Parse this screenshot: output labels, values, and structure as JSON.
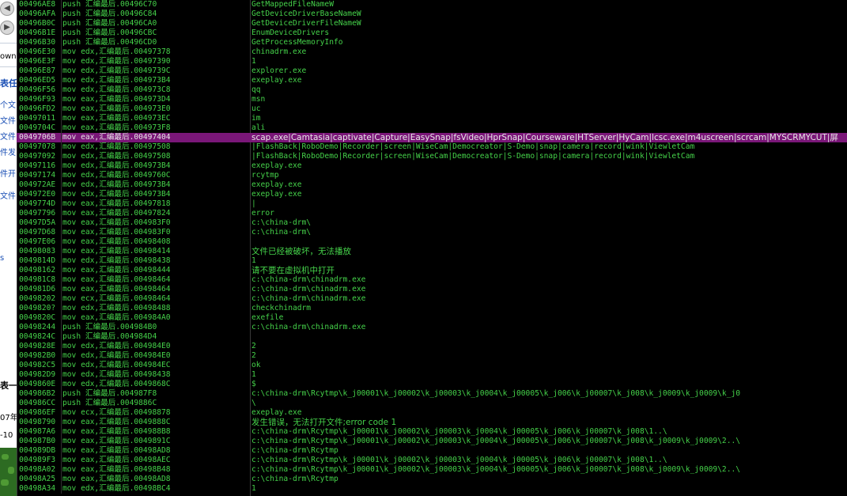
{
  "background_window": {
    "fragments": [
      "own",
      "表任",
      "个文",
      "文件",
      "文件",
      "件发",
      "件开",
      "文件",
      "s",
      "表一0",
      "07年",
      "-10"
    ]
  },
  "disasm": {
    "rows": [
      {
        "addr": "00496AE8",
        "instr": "push 汇编最后.00496C70",
        "comment": "GetMappedFileNameW"
      },
      {
        "addr": "00496AFA",
        "instr": "push 汇编最后.00496C84",
        "comment": "GetDeviceDriverBaseNameW"
      },
      {
        "addr": "00496B0C",
        "instr": "push 汇编最后.00496CA0",
        "comment": "GetDeviceDriverFileNameW"
      },
      {
        "addr": "00496B1E",
        "instr": "push 汇编最后.00496CBC",
        "comment": "EnumDeviceDrivers"
      },
      {
        "addr": "00496B30",
        "instr": "push 汇编最后.00496CD0",
        "comment": "GetProcessMemoryInfo"
      },
      {
        "addr": "00496E30",
        "instr": "mov edx,汇编最后.00497378",
        "comment": "chinadrm.exe"
      },
      {
        "addr": "00496E3F",
        "instr": "mov edx,汇编最后.00497390",
        "comment": "1"
      },
      {
        "addr": "00496E87",
        "instr": "mov edx,汇编最后.0049739C",
        "comment": "explorer.exe"
      },
      {
        "addr": "00496ED5",
        "instr": "mov edx,汇编最后.004973B4",
        "comment": "exeplay.exe"
      },
      {
        "addr": "00496F56",
        "instr": "mov edx,汇编最后.004973C8",
        "comment": "qq"
      },
      {
        "addr": "00496F93",
        "instr": "mov eax,汇编最后.004973D4",
        "comment": "msn"
      },
      {
        "addr": "00496FD2",
        "instr": "mov eax,汇编最后.004973E0",
        "comment": "uc"
      },
      {
        "addr": "00497011",
        "instr": "mov eax,汇编最后.004973EC",
        "comment": "im"
      },
      {
        "addr": "0049704C",
        "instr": "mov eax,汇编最后.004973F8",
        "comment": "ali"
      },
      {
        "addr": "0049706B",
        "instr": "mov eax,汇编最后.00497404",
        "comment": "scap.exe|Camtasia|captivate|Capture|EasySnap|fsVideo|HprSnap|Courseware|HTServer|HyCam|lcsc.exe|m4uscreen|scrcam|MYSCRMYCUT|屏",
        "selected": true
      },
      {
        "addr": "00497078",
        "instr": "mov edx,汇编最后.00497508",
        "comment": "|FlashBack|RoboDemo|Recorder|screen|WiseCam|Democreator|S-Demo|snap|camera|record|wink|ViewletCam"
      },
      {
        "addr": "00497092",
        "instr": "mov edx,汇编最后.00497508",
        "comment": "|FlashBack|RoboDemo|Recorder|screen|WiseCam|Democreator|S-Demo|snap|camera|record|wink|ViewletCam"
      },
      {
        "addr": "00497116",
        "instr": "mov edx,汇编最后.004973B4",
        "comment": "exeplay.exe"
      },
      {
        "addr": "00497174",
        "instr": "mov edx,汇编最后.0049760C",
        "comment": "rcytmp"
      },
      {
        "addr": "004972AE",
        "instr": "mov edx,汇编最后.004973B4",
        "comment": "exeplay.exe"
      },
      {
        "addr": "004972E0",
        "instr": "mov edx,汇编最后.004973B4",
        "comment": "exeplay.exe"
      },
      {
        "addr": "0049774D",
        "instr": "mov eax,汇编最后.00497818",
        "comment": "|"
      },
      {
        "addr": "00497796",
        "instr": "mov eax,汇编最后.00497824",
        "comment": "error"
      },
      {
        "addr": "00497D5A",
        "instr": "mov eax,汇编最后.004983F0",
        "comment": "c:\\china-drm\\"
      },
      {
        "addr": "00497D68",
        "instr": "mov eax,汇编最后.004983F0",
        "comment": "c:\\china-drm\\"
      },
      {
        "addr": "00497E06",
        "instr": "mov eax,汇编最后.00498408",
        "comment": ""
      },
      {
        "addr": "00498083",
        "instr": "mov eax,汇编最后.00498414",
        "comment": "文件已经被破坏，无法播放"
      },
      {
        "addr": "0049814D",
        "instr": "mov edx,汇编最后.00498438",
        "comment": "1"
      },
      {
        "addr": "00498162",
        "instr": "mov eax,汇编最后.00498444",
        "comment": "请不要在虚拟机中打开"
      },
      {
        "addr": "004981C8",
        "instr": "mov eax,汇编最后.00498464",
        "comment": "c:\\china-drm\\chinadrm.exe"
      },
      {
        "addr": "004981D6",
        "instr": "mov eax,汇编最后.00498464",
        "comment": "c:\\china-drm\\chinadrm.exe"
      },
      {
        "addr": "00498202",
        "instr": "mov ecx,汇编最后.00498464",
        "comment": "c:\\china-drm\\chinadrm.exe"
      },
      {
        "addr": "0049820?",
        "instr": "mov edx,汇编最后.00498488",
        "comment": "checkchinadrm"
      },
      {
        "addr": "0049820C",
        "instr": "mov eax,汇编最后.004984A0",
        "comment": "exefile"
      },
      {
        "addr": "00498244",
        "instr": "push 汇编最后.004984B0",
        "comment": "c:\\china-drm\\chinadrm.exe"
      },
      {
        "addr": "0049824C",
        "instr": "push 汇编最后.004984D4",
        "comment": ""
      },
      {
        "addr": "0049828E",
        "instr": "mov edx,汇编最后.004984E0",
        "comment": "2"
      },
      {
        "addr": "004982B0",
        "instr": "mov edx,汇编最后.004984E0",
        "comment": "2"
      },
      {
        "addr": "004982C5",
        "instr": "mov edx,汇编最后.004984EC",
        "comment": "ok"
      },
      {
        "addr": "004982D9",
        "instr": "mov edx,汇编最后.00498438",
        "comment": "1"
      },
      {
        "addr": "0049860E",
        "instr": "mov edx,汇编最后.0049868C",
        "comment": "$"
      },
      {
        "addr": "004986B2",
        "instr": "push 汇编最后.004987F8",
        "comment": "c:\\china-drm\\Rcytmp\\k_j00001\\k_j00002\\k_j00003\\k_j0004\\k_j00005\\k_j006\\k_j00007\\k_j008\\k_j0009\\k_j0009\\k_j0"
      },
      {
        "addr": "004986CC",
        "instr": "push 汇编最后.0049886C",
        "comment": "\\"
      },
      {
        "addr": "004986EF",
        "instr": "mov ecx,汇编最后.00498878",
        "comment": "exeplay.exe"
      },
      {
        "addr": "00498790",
        "instr": "mov eax,汇编最后.0049888C",
        "comment": "发生错误，无法打开文件;error code 1"
      },
      {
        "addr": "004987A6",
        "instr": "mov eax,汇编最后.004988B8",
        "comment": "c:\\china-drm\\Rcytmp\\k_j00001\\k_j00002\\k_j00003\\k_j0004\\k_j00005\\k_j006\\k_j00007\\k_j008\\1..\\"
      },
      {
        "addr": "004987B0",
        "instr": "mov eax,汇编最后.0049891C",
        "comment": "c:\\china-drm\\Rcytmp\\k_j00001\\k_j00002\\k_j00003\\k_j0004\\k_j00005\\k_j006\\k_j00007\\k_j008\\k_j0009\\k_j0009\\2..\\"
      },
      {
        "addr": "004989DB",
        "instr": "mov eax,汇编最后.00498AD8",
        "comment": "c:\\china-drm\\Rcytmp"
      },
      {
        "addr": "004989F3",
        "instr": "mov eax,汇编最后.00498AEC",
        "comment": "c:\\china-drm\\Rcytmp\\k_j00001\\k_j00002\\k_j00003\\k_j0004\\k_j00005\\k_j006\\k_j00007\\k_j008\\1..\\"
      },
      {
        "addr": "00498A02",
        "instr": "mov eax,汇编最后.00498B48",
        "comment": "c:\\china-drm\\Rcytmp\\k_j00001\\k_j00002\\k_j00003\\k_j0004\\k_j00005\\k_j006\\k_j00007\\k_j008\\k_j0009\\k_j0009\\2..\\"
      },
      {
        "addr": "00498A25",
        "instr": "mov eax,汇编最后.00498AD8",
        "comment": "c:\\china-drm\\Rcytmp"
      },
      {
        "addr": "00498A34",
        "instr": "mov edx,汇编最后.00498BC4",
        "comment": "1"
      }
    ]
  },
  "colors": {
    "background": "#000000",
    "text": "#45d24a",
    "selection": "#7a1778"
  }
}
